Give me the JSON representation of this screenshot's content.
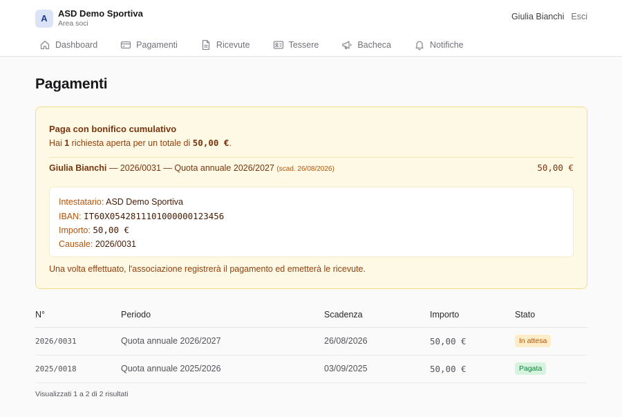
{
  "app": {
    "avatar_letter": "A",
    "title": "ASD Demo Sportiva",
    "subtitle": "Area soci"
  },
  "user": {
    "name": "Giulia Bianchi",
    "logout_label": "Esci"
  },
  "nav": {
    "items": [
      {
        "label": "Dashboard",
        "icon": "home-icon"
      },
      {
        "label": "Pagamenti",
        "icon": "credit-card-icon"
      },
      {
        "label": "Ricevute",
        "icon": "document-icon"
      },
      {
        "label": "Tessere",
        "icon": "id-card-icon"
      },
      {
        "label": "Bacheca",
        "icon": "megaphone-icon"
      },
      {
        "label": "Notifiche",
        "icon": "bell-icon"
      }
    ]
  },
  "page": {
    "title": "Pagamenti"
  },
  "transfer": {
    "title": "Paga con bonifico cumulativo",
    "summary_prefix": "Hai ",
    "count": "1",
    "summary_mid": " richiesta aperta per un totale di ",
    "total": "50,00 €",
    "summary_suffix": ".",
    "request": {
      "member": "Giulia Bianchi",
      "sep1": " — ",
      "number": "2026/0031",
      "sep2": " — ",
      "description": "Quota annuale 2026/2027",
      "due": "(scad. 26/08/2026)",
      "amount": "50,00 €"
    },
    "bank": {
      "holder_label": "Intestatario:",
      "holder_value": "ASD Demo Sportiva",
      "iban_label": "IBAN:",
      "iban_value": "IT60X0542811101000000123456",
      "amount_label": "Importo:",
      "amount_value": "50,00 €",
      "reason_label": "Causale:",
      "reason_value": "2026/0031"
    },
    "footer": "Una volta effettuato, l'associazione registrerà il pagamento ed emetterà le ricevute."
  },
  "table": {
    "headers": [
      "N°",
      "Periodo",
      "Scadenza",
      "Importo",
      "Stato"
    ],
    "rows": [
      {
        "number": "2026/0031",
        "period": "Quota annuale 2026/2027",
        "due": "26/08/2026",
        "amount": "50,00 €",
        "status": "In attesa"
      },
      {
        "number": "2025/0018",
        "period": "Quota annuale 2025/2026",
        "due": "03/09/2025",
        "amount": "50,00 €",
        "status": "Pagata"
      }
    ],
    "footer": "Visualizzati 1 a 2 di 2 risultati"
  }
}
